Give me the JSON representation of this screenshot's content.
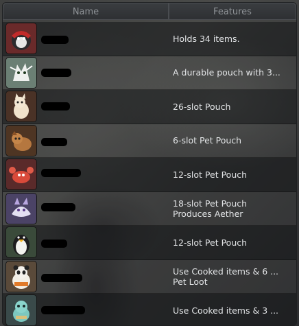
{
  "columns": {
    "name": "Name",
    "features": "Features"
  },
  "pets": [
    {
      "icon": "red-hood-penguin-icon",
      "features": [
        "Holds 34 items."
      ]
    },
    {
      "icon": "white-dragon-icon",
      "features": [
        "A durable pouch with 3..."
      ]
    },
    {
      "icon": "cream-cat-icon",
      "features": [
        "26-slot Pouch"
      ]
    },
    {
      "icon": "brown-pup-icon",
      "features": [
        "6-slot Pet Pouch"
      ]
    },
    {
      "icon": "red-crab-icon",
      "features": [
        "12-slot Pet Pouch"
      ]
    },
    {
      "icon": "purple-wolf-icon",
      "features": [
        "18-slot Pet Pouch",
        "Produces Aether"
      ]
    },
    {
      "icon": "penguin-icon",
      "features": [
        "12-slot Pet Pouch"
      ]
    },
    {
      "icon": "panda-cook-icon",
      "features": [
        "Use Cooked items & 6 ...",
        "Pet Loot"
      ]
    },
    {
      "icon": "teal-critter-icon",
      "features": [
        "Use Cooked items & 3 ..."
      ]
    }
  ]
}
